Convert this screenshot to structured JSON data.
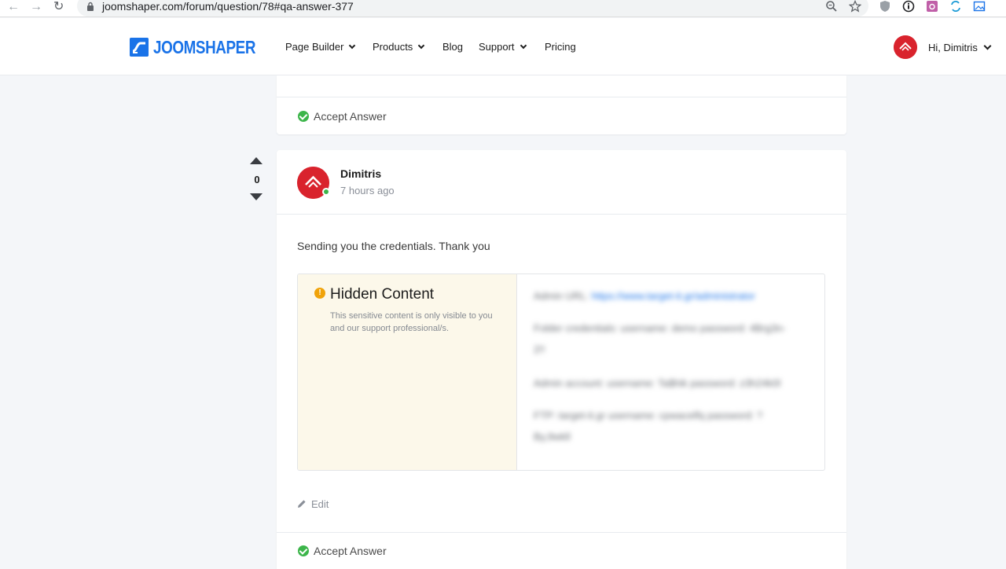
{
  "browser": {
    "url": "joomshaper.com/forum/question/78#qa-answer-377"
  },
  "header": {
    "logo_text": "JOOMSHAPER",
    "nav": [
      {
        "label": "Page Builder"
      },
      {
        "label": "Products"
      },
      {
        "label": "Blog"
      },
      {
        "label": "Support"
      },
      {
        "label": "Pricing"
      }
    ],
    "user_greeting": "Hi, Dimitris"
  },
  "previous_answer": {
    "accept_label": "Accept Answer"
  },
  "answer": {
    "vote_count": "0",
    "author": "Dimitris",
    "time": "7 hours ago",
    "body": "Sending you the credentials. Thank you",
    "hidden": {
      "title": "Hidden Content",
      "description": "This sensitive content is only visible to you and our support professional/s.",
      "lines": [
        {
          "prefix": "Admin URL: ",
          "link": "https://www.target-it.gr/administrator"
        },
        {
          "prefix": "Folder credentials: username: demo password: 4Brg3n-",
          "link": ""
        },
        {
          "prefix": "2!!",
          "link": ""
        },
        {
          "prefix": "Admin account: username: Ta$hik password: z3h24k0l",
          "link": ""
        },
        {
          "prefix": "FTP: target-it.gr username: cpwacelfq password: ?",
          "link": ""
        },
        {
          "prefix": "By,9wkll",
          "link": ""
        }
      ]
    },
    "edit_label": "Edit",
    "accept_label": "Accept Answer"
  },
  "colors": {
    "brand": "#1a73e8",
    "avatar": "#d9232d",
    "success": "#3cb54a",
    "warning": "#f0a30a"
  }
}
